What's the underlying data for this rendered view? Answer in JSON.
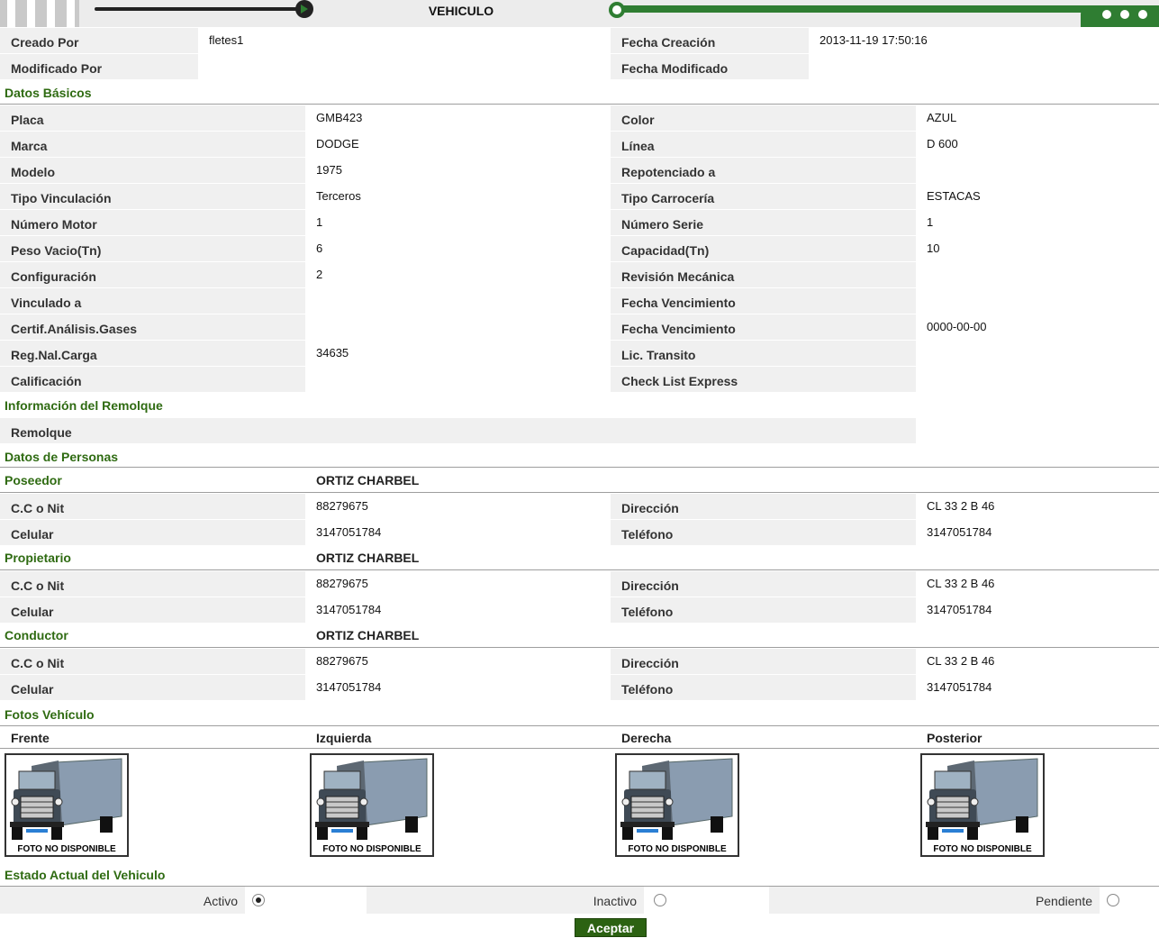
{
  "header": {
    "title": "VEHICULO"
  },
  "audit": [
    {
      "label": "Creado Por",
      "value": "fletes1",
      "label2": "Fecha Creación",
      "value2": "2013-11-19 17:50:16"
    },
    {
      "label": "Modificado Por",
      "value": "",
      "label2": "Fecha Modificado",
      "value2": ""
    }
  ],
  "sections": {
    "basic": "Datos Básicos",
    "trailer": "Información del Remolque",
    "people": "Datos de Personas",
    "photos": "Fotos Vehículo",
    "status": "Estado Actual del Vehiculo"
  },
  "basic_rows": [
    {
      "label": "Placa",
      "value": "GMB423",
      "label2": "Color",
      "value2": "AZUL"
    },
    {
      "label": "Marca",
      "value": "DODGE",
      "label2": "Línea",
      "value2": "D 600"
    },
    {
      "label": "Modelo",
      "value": "1975",
      "label2": "Repotenciado a",
      "value2": ""
    },
    {
      "label": "Tipo Vinculación",
      "value": "Terceros",
      "label2": "Tipo Carrocería",
      "value2": "ESTACAS"
    },
    {
      "label": "Número Motor",
      "value": "1",
      "label2": "Número Serie",
      "value2": "1"
    },
    {
      "label": "Peso Vacio(Tn)",
      "value": "6",
      "label2": "Capacidad(Tn)",
      "value2": "10"
    },
    {
      "label": "Configuración",
      "value": "2",
      "label2": "Revisión Mecánica",
      "value2": ""
    },
    {
      "label": "Vinculado a",
      "value": "",
      "label2": "Fecha Vencimiento",
      "value2": ""
    },
    {
      "label": "Certif.Análisis.Gases",
      "value": "",
      "label2": "Fecha Vencimiento",
      "value2": "0000-00-00"
    },
    {
      "label": "Reg.Nal.Carga",
      "value": "34635",
      "label2": "Lic. Transito",
      "value2": ""
    },
    {
      "label": "Calificación",
      "value": "",
      "label2": "Check List Express",
      "value2": ""
    }
  ],
  "trailer": {
    "label": "Remolque",
    "value": ""
  },
  "people": [
    {
      "role": "Poseedor",
      "name": "ORTIZ CHARBEL",
      "id_label": "C.C o Nit",
      "id": "88279675",
      "addr_label": "Dirección",
      "addr": "CL 33 2 B 46",
      "cell_label": "Celular",
      "cell": "3147051784",
      "phone_label": "Teléfono",
      "phone": "3147051784"
    },
    {
      "role": "Propietario",
      "name": "ORTIZ CHARBEL",
      "id_label": "C.C o Nit",
      "id": "88279675",
      "addr_label": "Dirección",
      "addr": "CL 33 2 B 46",
      "cell_label": "Celular",
      "cell": "3147051784",
      "phone_label": "Teléfono",
      "phone": "3147051784"
    },
    {
      "role": "Conductor",
      "name": "ORTIZ CHARBEL",
      "id_label": "C.C o Nit",
      "id": "88279675",
      "addr_label": "Dirección",
      "addr": "CL 33 2 B 46",
      "cell_label": "Celular",
      "cell": "3147051784",
      "phone_label": "Teléfono",
      "phone": "3147051784"
    }
  ],
  "photos": {
    "headers": [
      "Frente",
      "Izquierda",
      "Derecha",
      "Posterior"
    ],
    "caption": "FOTO NO DISPONIBLE"
  },
  "status": {
    "options": [
      "Activo",
      "Inactivo",
      "Pendiente"
    ],
    "selected": "Activo"
  },
  "accept_label": "Aceptar",
  "colors": {
    "section_green": "#2f6b12",
    "accent_green": "#2f7d32",
    "label_bg": "#f0f0f0"
  }
}
